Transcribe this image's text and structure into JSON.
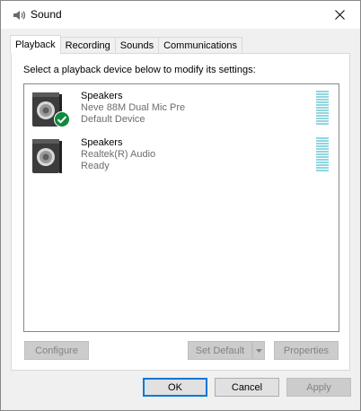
{
  "window": {
    "title": "Sound"
  },
  "tabs": [
    {
      "label": "Playback",
      "active": true
    },
    {
      "label": "Recording",
      "active": false
    },
    {
      "label": "Sounds",
      "active": false
    },
    {
      "label": "Communications",
      "active": false
    }
  ],
  "playback": {
    "instruction": "Select a playback device below to modify its settings:",
    "devices": [
      {
        "name": "Speakers",
        "description": "Neve 88M Dual Mic Pre",
        "status": "Default Device",
        "is_default": true,
        "icon": "speaker-icon",
        "level": 0
      },
      {
        "name": "Speakers",
        "description": "Realtek(R) Audio",
        "status": "Ready",
        "is_default": false,
        "icon": "speaker-icon",
        "level": 0
      }
    ],
    "buttons": {
      "configure": "Configure",
      "set_default": "Set Default",
      "properties": "Properties"
    }
  },
  "footer": {
    "ok": "OK",
    "cancel": "Cancel",
    "apply": "Apply"
  },
  "colors": {
    "accent": "#0078d7",
    "meter": "#8fd6e0",
    "default_check": "#10893e",
    "secondary_text": "#6d6d6d"
  }
}
